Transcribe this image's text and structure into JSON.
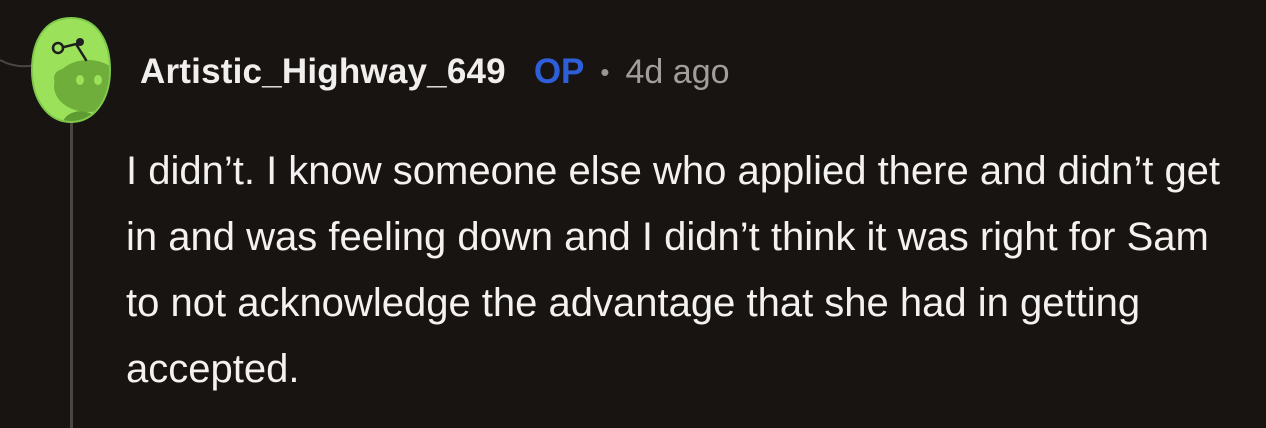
{
  "comment": {
    "username": "Artistic_Highway_649",
    "op_badge": "OP",
    "separator": "•",
    "time_ago": "4d ago",
    "body": "I didn’t. I know someone else who applied there and didn’t get in and was feeling down and I didn’t think it was right for Sam to not acknowledge the advantage that she had in getting accepted."
  },
  "icons": {
    "avatar": "reddit-snoo-avatar-icon"
  },
  "colors": {
    "background": "#181412",
    "avatar_bg": "#9be25a",
    "username": "#f1efed",
    "op_badge": "#2f5fd8",
    "meta_text": "#a39e9a",
    "body_text": "#f4f2f0",
    "thread_line": "#4a4643"
  }
}
